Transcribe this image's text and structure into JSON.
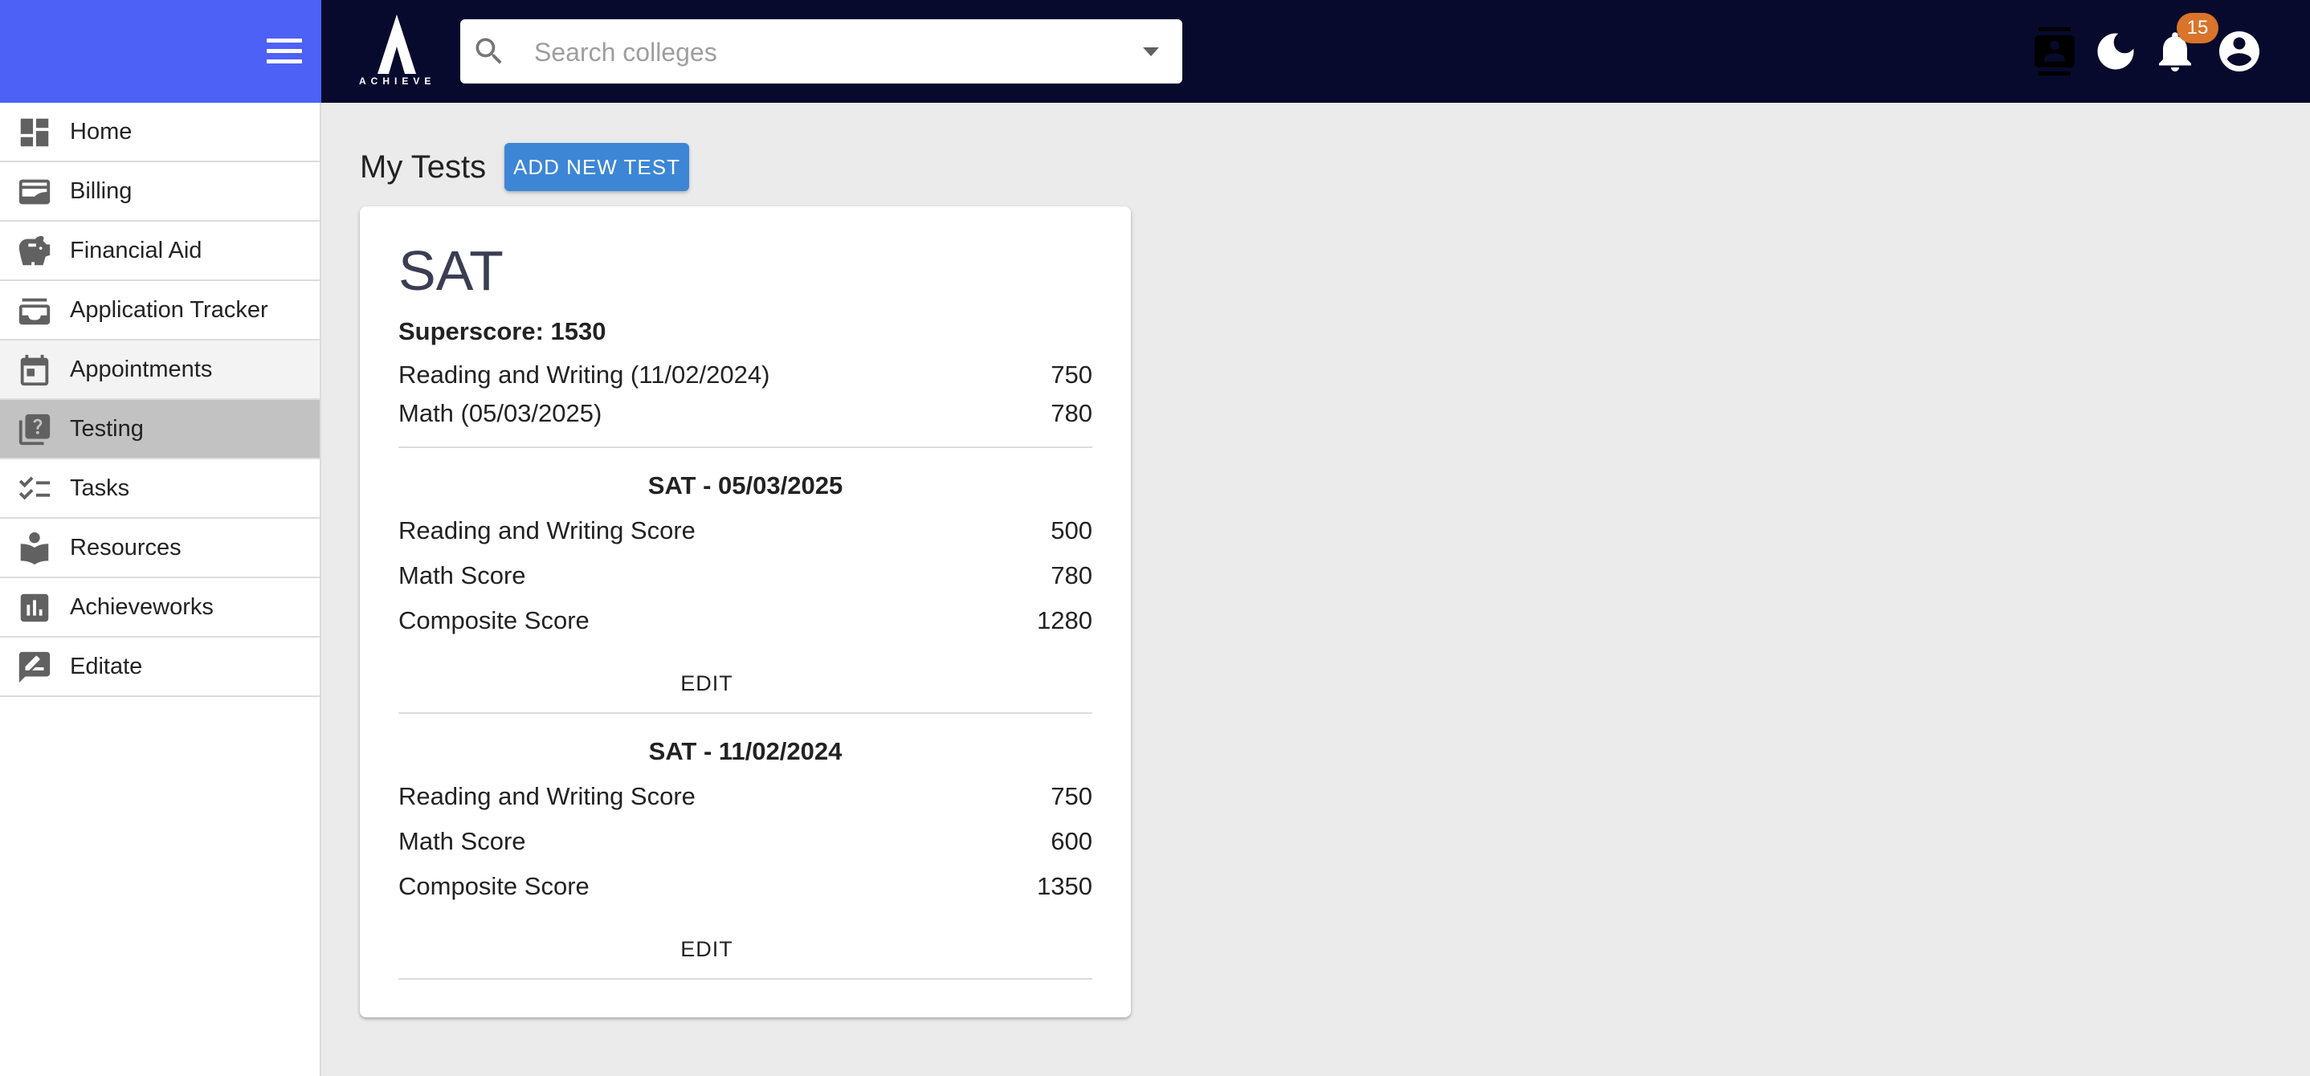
{
  "header": {
    "logo_text": "ACHIEVE",
    "search": {
      "placeholder": "Search colleges",
      "value": ""
    },
    "notification_count": "15",
    "icons": [
      "contacts-icon",
      "dark-mode-icon",
      "notifications-icon",
      "account-icon"
    ]
  },
  "colors": {
    "topbar": "#070a2d",
    "brand_panel": "#4d61f7",
    "primary_button": "#3d86d6",
    "badge": "#d9742a",
    "active_nav": "#c2c2c2"
  },
  "sidebar": {
    "items": [
      {
        "label": "Home",
        "icon": "dashboard-icon"
      },
      {
        "label": "Billing",
        "icon": "wallet-icon"
      },
      {
        "label": "Financial Aid",
        "icon": "piggy-bank-icon"
      },
      {
        "label": "Application Tracker",
        "icon": "inbox-tray-icon"
      },
      {
        "label": "Appointments",
        "icon": "calendar-icon"
      },
      {
        "label": "Testing",
        "icon": "quiz-icon"
      },
      {
        "label": "Tasks",
        "icon": "checklist-icon"
      },
      {
        "label": "Resources",
        "icon": "reader-icon"
      },
      {
        "label": "Achieveworks",
        "icon": "bar-chart-icon"
      },
      {
        "label": "Editate",
        "icon": "rate-review-icon"
      }
    ],
    "active": "Testing"
  },
  "main": {
    "title": "My Tests",
    "add_button": "ADD NEW TEST",
    "test": {
      "name": "SAT",
      "superscore": "Superscore: 1530",
      "super_rows": [
        {
          "label": "Reading and Writing (11/02/2024)",
          "value": "750"
        },
        {
          "label": "Math (05/03/2025)",
          "value": "780"
        }
      ],
      "sittings": [
        {
          "title": "SAT - 05/03/2025",
          "rows": [
            {
              "label": "Reading and Writing Score",
              "value": "500"
            },
            {
              "label": "Math Score",
              "value": "780"
            },
            {
              "label": "Composite Score",
              "value": "1280"
            }
          ],
          "edit_label": "EDIT"
        },
        {
          "title": "SAT - 11/02/2024",
          "rows": [
            {
              "label": "Reading and Writing Score",
              "value": "750"
            },
            {
              "label": "Math Score",
              "value": "600"
            },
            {
              "label": "Composite Score",
              "value": "1350"
            }
          ],
          "edit_label": "EDIT"
        }
      ]
    }
  }
}
